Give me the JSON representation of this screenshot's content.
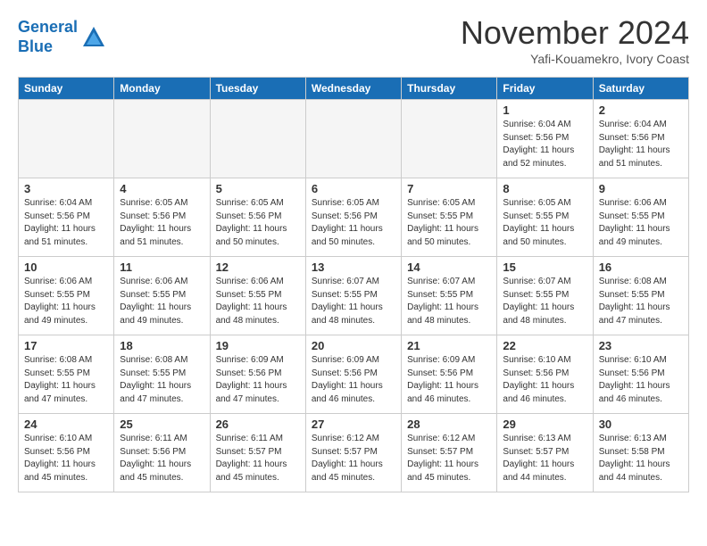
{
  "header": {
    "logo_line1": "General",
    "logo_line2": "Blue",
    "month": "November 2024",
    "location": "Yafi-Kouamekro, Ivory Coast"
  },
  "days_of_week": [
    "Sunday",
    "Monday",
    "Tuesday",
    "Wednesday",
    "Thursday",
    "Friday",
    "Saturday"
  ],
  "weeks": [
    [
      {
        "num": "",
        "info": ""
      },
      {
        "num": "",
        "info": ""
      },
      {
        "num": "",
        "info": ""
      },
      {
        "num": "",
        "info": ""
      },
      {
        "num": "",
        "info": ""
      },
      {
        "num": "1",
        "info": "Sunrise: 6:04 AM\nSunset: 5:56 PM\nDaylight: 11 hours\nand 52 minutes."
      },
      {
        "num": "2",
        "info": "Sunrise: 6:04 AM\nSunset: 5:56 PM\nDaylight: 11 hours\nand 51 minutes."
      }
    ],
    [
      {
        "num": "3",
        "info": "Sunrise: 6:04 AM\nSunset: 5:56 PM\nDaylight: 11 hours\nand 51 minutes."
      },
      {
        "num": "4",
        "info": "Sunrise: 6:05 AM\nSunset: 5:56 PM\nDaylight: 11 hours\nand 51 minutes."
      },
      {
        "num": "5",
        "info": "Sunrise: 6:05 AM\nSunset: 5:56 PM\nDaylight: 11 hours\nand 50 minutes."
      },
      {
        "num": "6",
        "info": "Sunrise: 6:05 AM\nSunset: 5:56 PM\nDaylight: 11 hours\nand 50 minutes."
      },
      {
        "num": "7",
        "info": "Sunrise: 6:05 AM\nSunset: 5:55 PM\nDaylight: 11 hours\nand 50 minutes."
      },
      {
        "num": "8",
        "info": "Sunrise: 6:05 AM\nSunset: 5:55 PM\nDaylight: 11 hours\nand 50 minutes."
      },
      {
        "num": "9",
        "info": "Sunrise: 6:06 AM\nSunset: 5:55 PM\nDaylight: 11 hours\nand 49 minutes."
      }
    ],
    [
      {
        "num": "10",
        "info": "Sunrise: 6:06 AM\nSunset: 5:55 PM\nDaylight: 11 hours\nand 49 minutes."
      },
      {
        "num": "11",
        "info": "Sunrise: 6:06 AM\nSunset: 5:55 PM\nDaylight: 11 hours\nand 49 minutes."
      },
      {
        "num": "12",
        "info": "Sunrise: 6:06 AM\nSunset: 5:55 PM\nDaylight: 11 hours\nand 48 minutes."
      },
      {
        "num": "13",
        "info": "Sunrise: 6:07 AM\nSunset: 5:55 PM\nDaylight: 11 hours\nand 48 minutes."
      },
      {
        "num": "14",
        "info": "Sunrise: 6:07 AM\nSunset: 5:55 PM\nDaylight: 11 hours\nand 48 minutes."
      },
      {
        "num": "15",
        "info": "Sunrise: 6:07 AM\nSunset: 5:55 PM\nDaylight: 11 hours\nand 48 minutes."
      },
      {
        "num": "16",
        "info": "Sunrise: 6:08 AM\nSunset: 5:55 PM\nDaylight: 11 hours\nand 47 minutes."
      }
    ],
    [
      {
        "num": "17",
        "info": "Sunrise: 6:08 AM\nSunset: 5:55 PM\nDaylight: 11 hours\nand 47 minutes."
      },
      {
        "num": "18",
        "info": "Sunrise: 6:08 AM\nSunset: 5:55 PM\nDaylight: 11 hours\nand 47 minutes."
      },
      {
        "num": "19",
        "info": "Sunrise: 6:09 AM\nSunset: 5:56 PM\nDaylight: 11 hours\nand 47 minutes."
      },
      {
        "num": "20",
        "info": "Sunrise: 6:09 AM\nSunset: 5:56 PM\nDaylight: 11 hours\nand 46 minutes."
      },
      {
        "num": "21",
        "info": "Sunrise: 6:09 AM\nSunset: 5:56 PM\nDaylight: 11 hours\nand 46 minutes."
      },
      {
        "num": "22",
        "info": "Sunrise: 6:10 AM\nSunset: 5:56 PM\nDaylight: 11 hours\nand 46 minutes."
      },
      {
        "num": "23",
        "info": "Sunrise: 6:10 AM\nSunset: 5:56 PM\nDaylight: 11 hours\nand 46 minutes."
      }
    ],
    [
      {
        "num": "24",
        "info": "Sunrise: 6:10 AM\nSunset: 5:56 PM\nDaylight: 11 hours\nand 45 minutes."
      },
      {
        "num": "25",
        "info": "Sunrise: 6:11 AM\nSunset: 5:56 PM\nDaylight: 11 hours\nand 45 minutes."
      },
      {
        "num": "26",
        "info": "Sunrise: 6:11 AM\nSunset: 5:57 PM\nDaylight: 11 hours\nand 45 minutes."
      },
      {
        "num": "27",
        "info": "Sunrise: 6:12 AM\nSunset: 5:57 PM\nDaylight: 11 hours\nand 45 minutes."
      },
      {
        "num": "28",
        "info": "Sunrise: 6:12 AM\nSunset: 5:57 PM\nDaylight: 11 hours\nand 45 minutes."
      },
      {
        "num": "29",
        "info": "Sunrise: 6:13 AM\nSunset: 5:57 PM\nDaylight: 11 hours\nand 44 minutes."
      },
      {
        "num": "30",
        "info": "Sunrise: 6:13 AM\nSunset: 5:58 PM\nDaylight: 11 hours\nand 44 minutes."
      }
    ]
  ]
}
